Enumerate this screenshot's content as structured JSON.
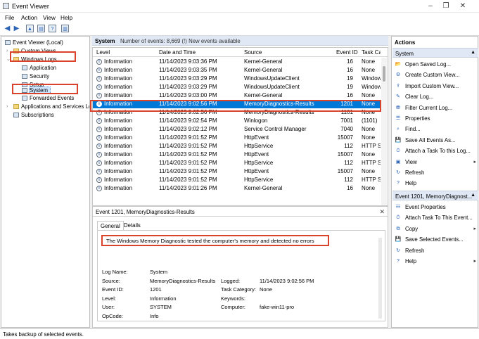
{
  "window": {
    "title": "Event Viewer"
  },
  "menu": [
    "File",
    "Action",
    "View",
    "Help"
  ],
  "tree": {
    "root": "Event Viewer (Local)",
    "custom_views": "Custom Views",
    "windows_logs": "Windows Logs",
    "application": "Application",
    "security": "Security",
    "setup": "Setup",
    "system": "System",
    "forwarded": "Forwarded Events",
    "app_services": "Applications and Services Lo",
    "subscriptions": "Subscriptions"
  },
  "center": {
    "log_name": "System",
    "events_info": "Number of events: 8,669 (!) New events available",
    "columns": [
      "Level",
      "Date and Time",
      "Source",
      "Event ID",
      "Task Cat"
    ],
    "rows": [
      [
        "Information",
        "11/14/2023 9:03:36 PM",
        "Kernel-General",
        "16",
        "None"
      ],
      [
        "Information",
        "11/14/2023 9:03:35 PM",
        "Kernel-General",
        "16",
        "None"
      ],
      [
        "Information",
        "11/14/2023 9:03:29 PM",
        "WindowsUpdateClient",
        "19",
        "Window"
      ],
      [
        "Information",
        "11/14/2023 9:03:29 PM",
        "WindowsUpdateClient",
        "19",
        "Window"
      ],
      [
        "Information",
        "11/14/2023 9:03:00 PM",
        "Kernel-General",
        "16",
        "None"
      ],
      [
        "Information",
        "11/14/2023 9:02:56 PM",
        "MemoryDiagnostics-Results",
        "1201",
        "None"
      ],
      [
        "Information",
        "11/14/2023 9:02:56 PM",
        "MemoryDiagnostics-Results",
        "1101",
        "None"
      ],
      [
        "Information",
        "11/14/2023 9:02:54 PM",
        "Winlogon",
        "7001",
        "(1101)"
      ],
      [
        "Information",
        "11/14/2023 9:02:12 PM",
        "Service Control Manager",
        "7040",
        "None"
      ],
      [
        "Information",
        "11/14/2023 9:01:52 PM",
        "HttpEvent",
        "15007",
        "None"
      ],
      [
        "Information",
        "11/14/2023 9:01:52 PM",
        "HttpService",
        "112",
        "HTTP Se"
      ],
      [
        "Information",
        "11/14/2023 9:01:52 PM",
        "HttpEvent",
        "15007",
        "None"
      ],
      [
        "Information",
        "11/14/2023 9:01:52 PM",
        "HttpService",
        "112",
        "HTTP Se"
      ],
      [
        "Information",
        "11/14/2023 9:01:52 PM",
        "HttpEvent",
        "15007",
        "None"
      ],
      [
        "Information",
        "11/14/2023 9:01:52 PM",
        "HttpService",
        "112",
        "HTTP Se"
      ],
      [
        "Information",
        "11/14/2023 9:01:26 PM",
        "Kernel-General",
        "16",
        "None"
      ]
    ]
  },
  "details": {
    "title": "Event 1201, MemoryDiagnostics-Results",
    "tabs": [
      "General",
      "Details"
    ],
    "description": "The Windows Memory Diagnostic tested the computer's memory and detected no errors",
    "labels": {
      "log_name": "Log Name:",
      "source": "Source:",
      "event_id": "Event ID:",
      "level": "Level:",
      "user": "User:",
      "opcode": "OpCode:",
      "logged": "Logged:",
      "task_category": "Task Category:",
      "keywords": "Keywords:",
      "computer": "Computer:"
    },
    "values": {
      "log_name": "System",
      "source": "MemoryDiagnostics-Results",
      "event_id": "1201",
      "level": "Information",
      "user": "SYSTEM",
      "opcode": "Info",
      "logged": "11/14/2023 9:02:56 PM",
      "task_category": "None",
      "keywords": "",
      "computer": "fake-win11-pro"
    }
  },
  "actions": {
    "title": "Actions",
    "section1": "System",
    "items1": [
      "Open Saved Log...",
      "Create Custom View...",
      "Import Custom View...",
      "Clear Log...",
      "Filter Current Log...",
      "Properties",
      "Find...",
      "Save All Events As...",
      "Attach a Task To this Log...",
      "View",
      "Refresh",
      "Help"
    ],
    "section2": "Event 1201, MemoryDiagnost...",
    "items2": [
      "Event Properties",
      "Attach Task To This Event...",
      "Copy",
      "Save Selected Events...",
      "Refresh",
      "Help"
    ]
  },
  "status": "Takes backup of selected events."
}
